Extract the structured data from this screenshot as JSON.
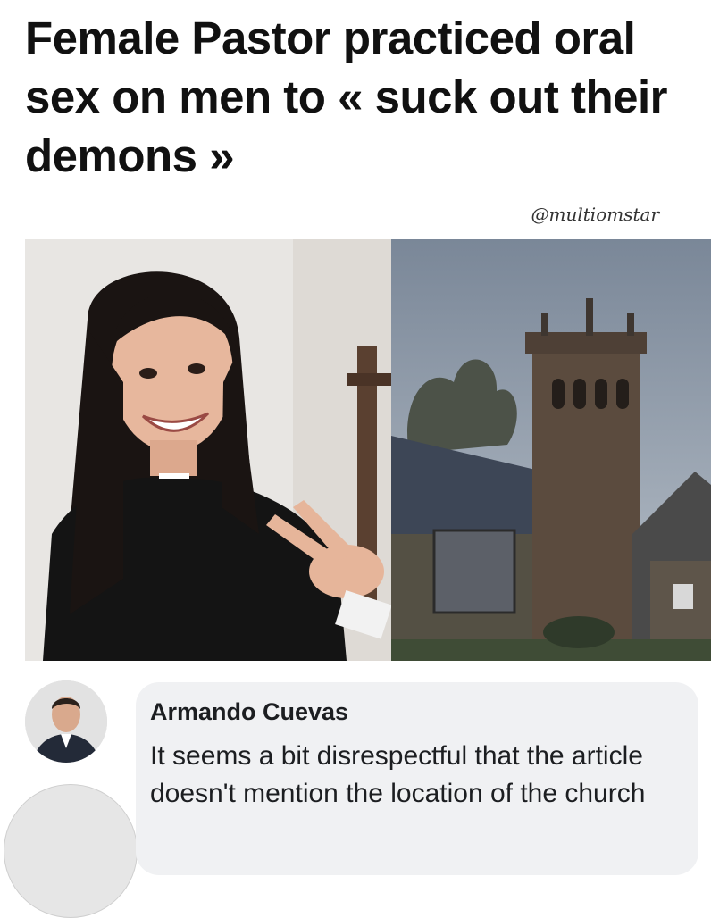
{
  "post": {
    "headline": "Female Pastor practiced oral sex on men to « suck out their demons »",
    "watermark": "@multiomstar"
  },
  "images": {
    "left_icon": "woman-portrait-photo",
    "right_icon": "church-photo"
  },
  "comment": {
    "avatar_icon": "man-portrait-avatar",
    "author": "Armando Cuevas",
    "text": "It seems a bit disrespectful that the article doesn't mention the location of the church"
  },
  "colors": {
    "bubble_bg": "#f0f1f3",
    "text": "#1c1e21",
    "headline": "#111111"
  }
}
